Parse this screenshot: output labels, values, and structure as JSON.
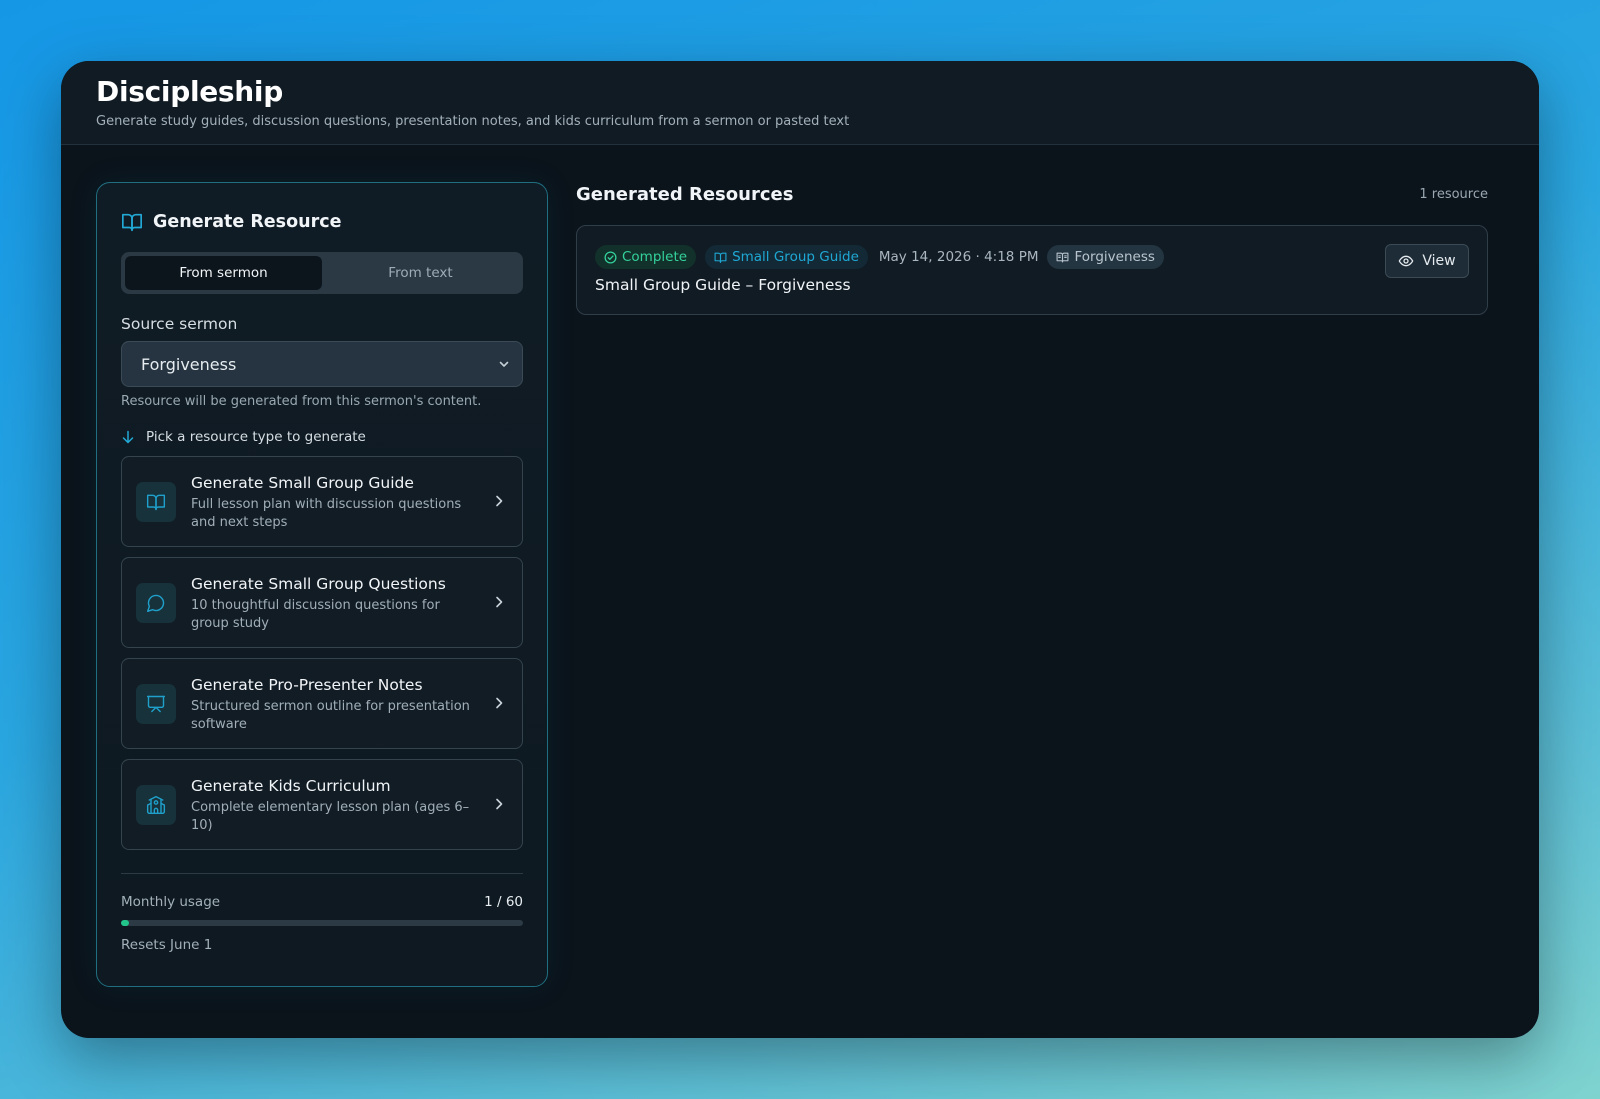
{
  "header": {
    "title": "Discipleship",
    "subtitle": "Generate study guides, discussion questions, presentation notes, and kids curriculum from a sermon or pasted text"
  },
  "generate_panel": {
    "title": "Generate Resource",
    "title_icon": "book-open-icon",
    "tabs": [
      {
        "label": "From sermon",
        "active": true
      },
      {
        "label": "From text",
        "active": false
      }
    ],
    "source_label": "Source sermon",
    "source_value": "Forgiveness",
    "source_hint": "Resource will be generated from this sermon's content.",
    "pick_prompt": "Pick a resource type to generate",
    "resource_types": [
      {
        "icon": "book-open-icon",
        "title": "Generate Small Group Guide",
        "description": "Full lesson plan with discussion questions and next steps"
      },
      {
        "icon": "chat-bubble-icon",
        "title": "Generate Small Group Questions",
        "description": "10 thoughtful discussion questions for group study"
      },
      {
        "icon": "presentation-icon",
        "title": "Generate Pro-Presenter Notes",
        "description": "Structured sermon outline for presentation software"
      },
      {
        "icon": "school-icon",
        "title": "Generate Kids Curriculum",
        "description": "Complete elementary lesson plan (ages 6–10)"
      }
    ],
    "usage": {
      "label": "Monthly usage",
      "count_text": "1 / 60",
      "used": 1,
      "limit": 60,
      "resets": "Resets June 1"
    }
  },
  "generated": {
    "title": "Generated Resources",
    "count_text": "1 resource",
    "items": [
      {
        "status": "Complete",
        "type": "Small Group Guide",
        "date": "May 14, 2026 · 4:18 PM",
        "sermon": "Forgiveness",
        "title": "Small Group Guide – Forgiveness",
        "action": "View"
      }
    ]
  },
  "colors": {
    "accent": "#1fa7d4",
    "success": "#34d19a",
    "progress": "#22c58a",
    "panel_border": "#1f6f80"
  }
}
